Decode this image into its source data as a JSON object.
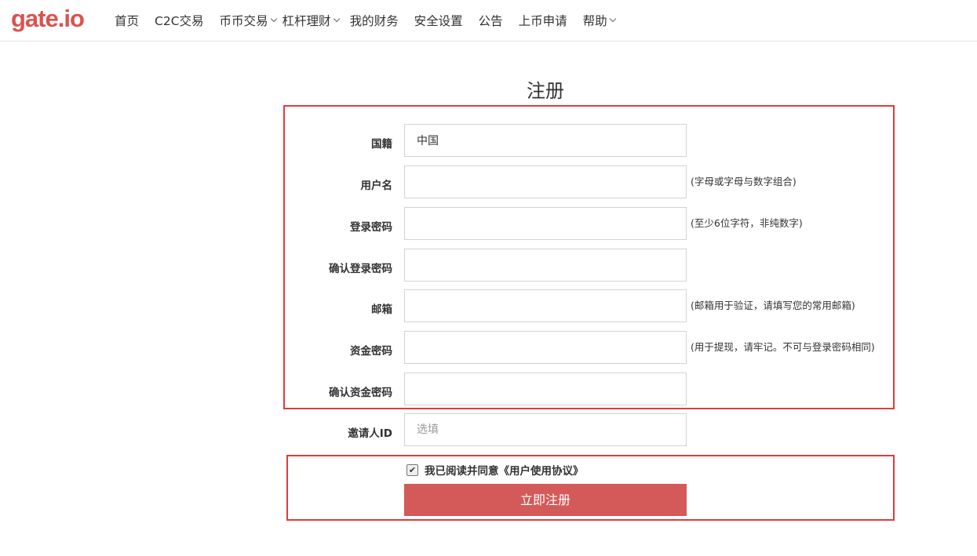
{
  "header": {
    "logo": "gate.io",
    "nav": [
      {
        "label": "首页",
        "dropdown": false
      },
      {
        "label": "C2C交易",
        "dropdown": false
      },
      {
        "label": "币币交易",
        "dropdown": true
      },
      {
        "label": "杠杆理财",
        "dropdown": true
      },
      {
        "label": "我的财务",
        "dropdown": false
      },
      {
        "label": "安全设置",
        "dropdown": false
      },
      {
        "label": "公告",
        "dropdown": false
      },
      {
        "label": "上币申请",
        "dropdown": false
      },
      {
        "label": "帮助",
        "dropdown": true
      }
    ]
  },
  "form": {
    "title": "注册",
    "fields": [
      {
        "label": "国籍",
        "value": "中国",
        "placeholder": "",
        "hint": ""
      },
      {
        "label": "用户名",
        "value": "",
        "placeholder": "",
        "hint": "(字母或字母与数字组合)"
      },
      {
        "label": "登录密码",
        "value": "",
        "placeholder": "",
        "hint": "(至少6位字符，非纯数字)"
      },
      {
        "label": "确认登录密码",
        "value": "",
        "placeholder": "",
        "hint": ""
      },
      {
        "label": "邮箱",
        "value": "",
        "placeholder": "",
        "hint": "(邮箱用于验证，请填写您的常用邮箱)"
      },
      {
        "label": "资金密码",
        "value": "",
        "placeholder": "",
        "hint": "(用于提现，请牢记。不可与登录密码相同)"
      },
      {
        "label": "确认资金密码",
        "value": "",
        "placeholder": "",
        "hint": ""
      },
      {
        "label": "邀请人ID",
        "value": "",
        "placeholder": "选填",
        "hint": ""
      }
    ],
    "agree_text": "我已阅读并同意《用户使用协议》",
    "agree_checked": true,
    "submit_label": "立即注册"
  },
  "colors": {
    "brand": "#d9534f",
    "submit": "#d35a58",
    "highlight_box": "#e03c3c"
  }
}
